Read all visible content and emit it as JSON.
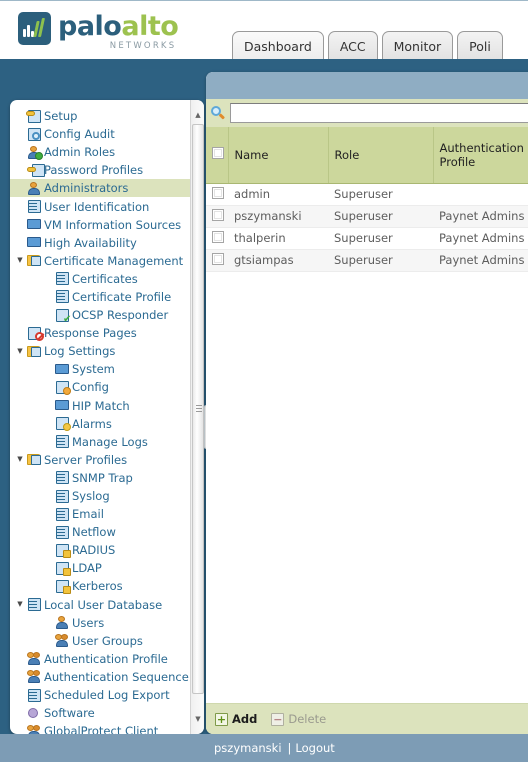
{
  "brand": {
    "word_1": "palo",
    "word_2": "alto",
    "sub": "NETWORKS",
    "logo_icon": "paloalto-logo-icon",
    "accent_teal": "#2c5f7c",
    "accent_green": "#9dc24f"
  },
  "tabs": [
    {
      "label": "Dashboard",
      "active": true
    },
    {
      "label": "ACC",
      "active": false
    },
    {
      "label": "Monitor",
      "active": false
    },
    {
      "label": "Poli",
      "active": false
    }
  ],
  "sidebar": {
    "scroll_up_icon": "triangle-up-icon",
    "scroll_down_icon": "triangle-down-icon",
    "items": [
      {
        "label": "Setup",
        "indent": 0,
        "icon": "setup-icon",
        "expander": "",
        "selected": false
      },
      {
        "label": "Config Audit",
        "indent": 0,
        "icon": "config-audit-icon",
        "expander": "",
        "selected": false
      },
      {
        "label": "Admin Roles",
        "indent": 0,
        "icon": "admin-roles-icon",
        "expander": "",
        "selected": false
      },
      {
        "label": "Password Profiles",
        "indent": 0,
        "icon": "password-profiles-icon",
        "expander": "",
        "selected": false
      },
      {
        "label": "Administrators",
        "indent": 0,
        "icon": "administrators-icon",
        "expander": "",
        "selected": true
      },
      {
        "label": "User Identification",
        "indent": 0,
        "icon": "user-identification-icon",
        "expander": "",
        "selected": false
      },
      {
        "label": "VM Information Sources",
        "indent": 0,
        "icon": "vm-information-icon",
        "expander": "",
        "selected": false
      },
      {
        "label": "High Availability",
        "indent": 0,
        "icon": "high-availability-icon",
        "expander": "",
        "selected": false
      },
      {
        "label": "Certificate Management",
        "indent": 0,
        "icon": "folder-certificate-icon",
        "expander": "▼",
        "selected": false
      },
      {
        "label": "Certificates",
        "indent": 2,
        "icon": "certificate-icon",
        "expander": "",
        "selected": false
      },
      {
        "label": "Certificate Profile",
        "indent": 2,
        "icon": "certificate-icon",
        "expander": "",
        "selected": false
      },
      {
        "label": "OCSP Responder",
        "indent": 2,
        "icon": "ocsp-responder-icon",
        "expander": "",
        "selected": false
      },
      {
        "label": "Response Pages",
        "indent": 0,
        "icon": "response-pages-icon",
        "expander": "",
        "selected": false
      },
      {
        "label": "Log Settings",
        "indent": 0,
        "icon": "folder-log-icon",
        "expander": "▼",
        "selected": false
      },
      {
        "label": "System",
        "indent": 2,
        "icon": "system-log-icon",
        "expander": "",
        "selected": false
      },
      {
        "label": "Config",
        "indent": 2,
        "icon": "config-log-icon",
        "expander": "",
        "selected": false
      },
      {
        "label": "HIP Match",
        "indent": 2,
        "icon": "hip-match-icon",
        "expander": "",
        "selected": false
      },
      {
        "label": "Alarms",
        "indent": 2,
        "icon": "alarms-icon",
        "expander": "",
        "selected": false
      },
      {
        "label": "Manage Logs",
        "indent": 2,
        "icon": "manage-logs-icon",
        "expander": "",
        "selected": false
      },
      {
        "label": "Server Profiles",
        "indent": 0,
        "icon": "folder-server-icon",
        "expander": "▼",
        "selected": false
      },
      {
        "label": "SNMP Trap",
        "indent": 2,
        "icon": "server-profile-icon",
        "expander": "",
        "selected": false
      },
      {
        "label": "Syslog",
        "indent": 2,
        "icon": "server-profile-icon",
        "expander": "",
        "selected": false
      },
      {
        "label": "Email",
        "indent": 2,
        "icon": "server-profile-icon",
        "expander": "",
        "selected": false
      },
      {
        "label": "Netflow",
        "indent": 2,
        "icon": "server-profile-icon",
        "expander": "",
        "selected": false
      },
      {
        "label": "RADIUS",
        "indent": 2,
        "icon": "radius-icon",
        "expander": "",
        "selected": false
      },
      {
        "label": "LDAP",
        "indent": 2,
        "icon": "ldap-icon",
        "expander": "",
        "selected": false
      },
      {
        "label": "Kerberos",
        "indent": 2,
        "icon": "kerberos-icon",
        "expander": "",
        "selected": false
      },
      {
        "label": "Local User Database",
        "indent": 0,
        "icon": "local-user-database-icon",
        "expander": "▼",
        "selected": false
      },
      {
        "label": "Users",
        "indent": 2,
        "icon": "users-icon",
        "expander": "",
        "selected": false
      },
      {
        "label": "User Groups",
        "indent": 2,
        "icon": "user-groups-icon",
        "expander": "",
        "selected": false
      },
      {
        "label": "Authentication Profile",
        "indent": 0,
        "icon": "authentication-profile-icon",
        "expander": "",
        "selected": false
      },
      {
        "label": "Authentication Sequence",
        "indent": 0,
        "icon": "authentication-sequence-icon",
        "expander": "",
        "selected": false
      },
      {
        "label": "Scheduled Log Export",
        "indent": 0,
        "icon": "scheduled-log-export-icon",
        "expander": "",
        "selected": false
      },
      {
        "label": "Software",
        "indent": 0,
        "icon": "software-icon",
        "expander": "",
        "selected": false
      },
      {
        "label": "GlobalProtect Client",
        "indent": 0,
        "icon": "globalprotect-client-icon",
        "expander": "",
        "selected": false
      }
    ]
  },
  "collapse_handle": {
    "icon": "collapse-left-icon",
    "glyph": "◀"
  },
  "search": {
    "icon": "search-icon",
    "value": "",
    "placeholder": ""
  },
  "table": {
    "columns": [
      {
        "key": "checkbox",
        "label": ""
      },
      {
        "key": "name",
        "label": "Name"
      },
      {
        "key": "role",
        "label": "Role"
      },
      {
        "key": "auth",
        "label": "Authentication Profile"
      }
    ],
    "rows": [
      {
        "checked": false,
        "name": "admin",
        "role": "Superuser",
        "auth": ""
      },
      {
        "checked": false,
        "name": "pszymanski",
        "role": "Superuser",
        "auth": "Paynet Admins"
      },
      {
        "checked": false,
        "name": "thalperin",
        "role": "Superuser",
        "auth": "Paynet Admins"
      },
      {
        "checked": false,
        "name": "gtsiampas",
        "role": "Superuser",
        "auth": "Paynet Admins"
      }
    ]
  },
  "actions": {
    "add": {
      "label": "Add",
      "glyph": "+",
      "icon": "add-icon",
      "enabled": true
    },
    "delete": {
      "label": "Delete",
      "glyph": "−",
      "icon": "delete-icon",
      "enabled": false
    }
  },
  "status": {
    "user": "pszymanski",
    "separator": "|",
    "logout": "Logout"
  }
}
